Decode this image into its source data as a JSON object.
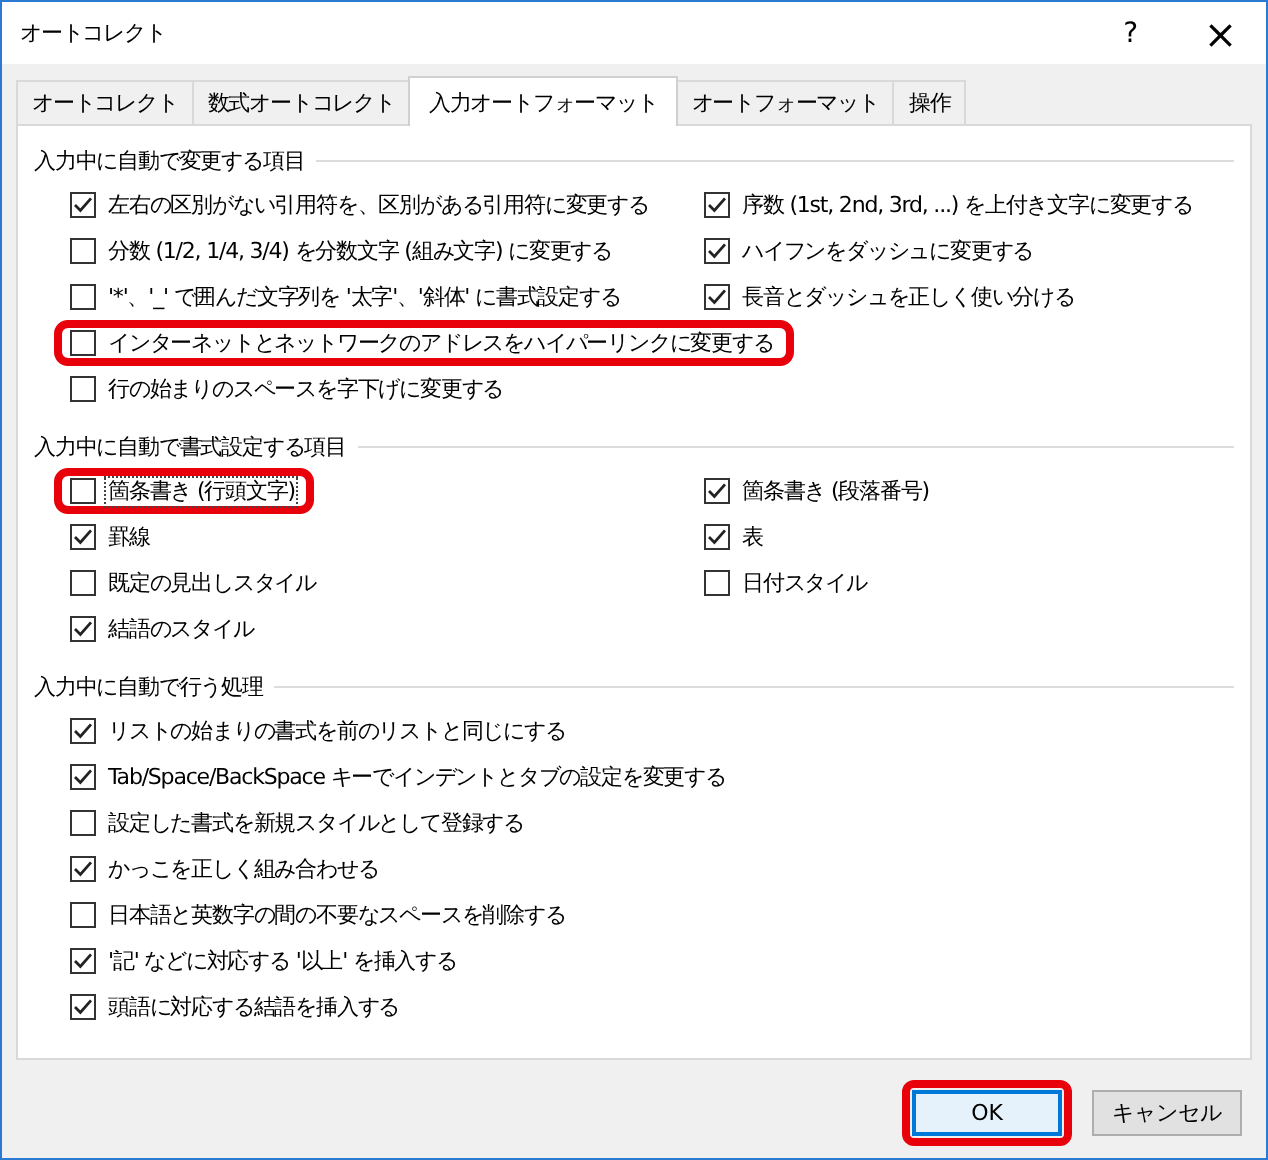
{
  "window": {
    "title": "オートコレクト",
    "help": "?",
    "close": "×"
  },
  "tabs": [
    {
      "label": "オートコレクト",
      "selected": false
    },
    {
      "label": "数式オートコレクト",
      "selected": false
    },
    {
      "label": "入力オートフォーマット",
      "selected": true
    },
    {
      "label": "オートフォーマット",
      "selected": false
    },
    {
      "label": "操作",
      "selected": false
    }
  ],
  "sections": [
    {
      "title": "入力中に自動で変更する項目",
      "columns": [
        [
          {
            "label": "左右の区別がない引用符を、区別がある引用符に変更する",
            "checked": true,
            "focused": false,
            "highlighted": false
          },
          {
            "label": "分数 (1/2, 1/4, 3/4) を分数文字 (組み文字) に変更する",
            "checked": false,
            "focused": false,
            "highlighted": false
          },
          {
            "label": "'*'、'_' で囲んだ文字列を '太字'、'斜体' に書式設定する",
            "checked": false,
            "focused": false,
            "highlighted": false
          },
          {
            "label": "インターネットとネットワークのアドレスをハイパーリンクに変更する",
            "checked": false,
            "focused": false,
            "highlighted": true
          },
          {
            "label": "行の始まりのスペースを字下げに変更する",
            "checked": false,
            "focused": false,
            "highlighted": false
          }
        ],
        [
          {
            "label": "序数 (1st, 2nd, 3rd, ...) を上付き文字に変更する",
            "checked": true,
            "focused": false,
            "highlighted": false
          },
          {
            "label": "ハイフンをダッシュに変更する",
            "checked": true,
            "focused": false,
            "highlighted": false
          },
          {
            "label": "長音とダッシュを正しく使い分ける",
            "checked": true,
            "focused": false,
            "highlighted": false
          }
        ]
      ]
    },
    {
      "title": "入力中に自動で書式設定する項目",
      "columns": [
        [
          {
            "label": "箇条書き (行頭文字)",
            "checked": false,
            "focused": true,
            "highlighted": true
          },
          {
            "label": "罫線",
            "checked": true,
            "focused": false,
            "highlighted": false
          },
          {
            "label": "既定の見出しスタイル",
            "checked": false,
            "focused": false,
            "highlighted": false
          },
          {
            "label": "結語のスタイル",
            "checked": true,
            "focused": false,
            "highlighted": false
          }
        ],
        [
          {
            "label": "箇条書き (段落番号)",
            "checked": true,
            "focused": false,
            "highlighted": false
          },
          {
            "label": "表",
            "checked": true,
            "focused": false,
            "highlighted": false
          },
          {
            "label": "日付スタイル",
            "checked": false,
            "focused": false,
            "highlighted": false
          }
        ]
      ]
    },
    {
      "title": "入力中に自動で行う処理",
      "columns": [
        [
          {
            "label": "リストの始まりの書式を前のリストと同じにする",
            "checked": true,
            "focused": false,
            "highlighted": false
          },
          {
            "label": "Tab/Space/BackSpace キーでインデントとタブの設定を変更する",
            "checked": true,
            "focused": false,
            "highlighted": false
          },
          {
            "label": "設定した書式を新規スタイルとして登録する",
            "checked": false,
            "focused": false,
            "highlighted": false
          },
          {
            "label": "かっこを正しく組み合わせる",
            "checked": true,
            "focused": false,
            "highlighted": false
          },
          {
            "label": "日本語と英数字の間の不要なスペースを削除する",
            "checked": false,
            "focused": false,
            "highlighted": false
          },
          {
            "label": "'記' などに対応する '以上' を挿入する",
            "checked": true,
            "focused": false,
            "highlighted": false
          },
          {
            "label": "頭語に対応する結語を挿入する",
            "checked": true,
            "focused": false,
            "highlighted": false
          }
        ]
      ]
    }
  ],
  "buttons": [
    {
      "label": "OK",
      "default": true,
      "highlighted": true
    },
    {
      "label": "キャンセル",
      "default": false,
      "highlighted": false
    }
  ]
}
